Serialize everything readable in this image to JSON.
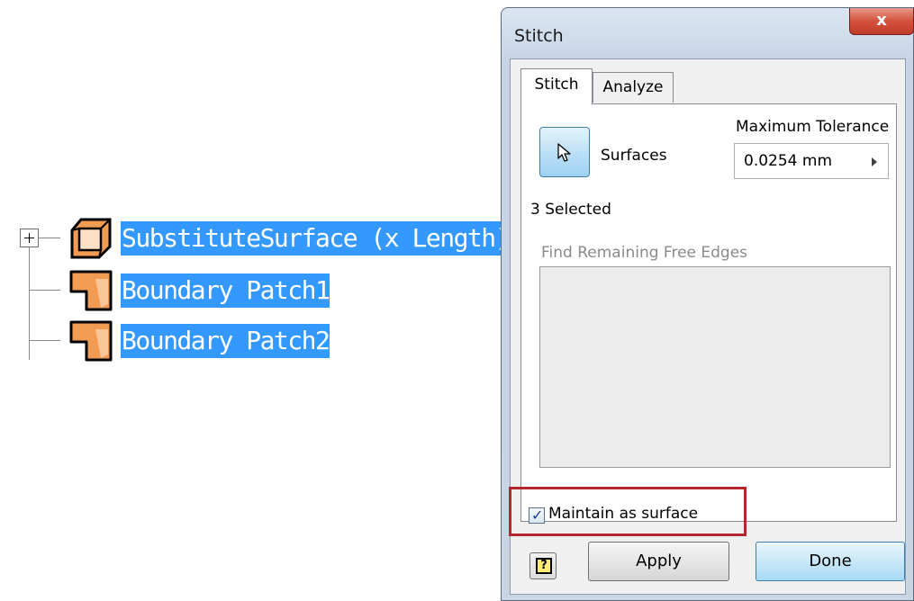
{
  "tree": {
    "items": [
      {
        "label": "SubstituteSurface (x Length)",
        "icon": "substitute-surface-icon"
      },
      {
        "label": "Boundary Patch1",
        "icon": "boundary-patch-icon"
      },
      {
        "label": "Boundary Patch2",
        "icon": "boundary-patch-icon"
      }
    ]
  },
  "dialog": {
    "title": "Stitch",
    "close_label": "x",
    "tabs": [
      {
        "label": "Stitch",
        "active": true
      },
      {
        "label": "Analyze",
        "active": false
      }
    ],
    "surfaces_label": "Surfaces",
    "max_tolerance_label": "Maximum Tolerance",
    "tolerance_value": "0.0254 mm",
    "selected_count": "3 Selected",
    "find_edges_label": "Find Remaining Free Edges",
    "maintain_label": "Maintain as surface",
    "maintain_checked": true,
    "help_label": "?",
    "apply_label": "Apply",
    "done_label": "Done"
  },
  "colors": {
    "selection": "#3399ff",
    "patch_orange": "#f29b52",
    "highlight_red": "#b5262e"
  }
}
